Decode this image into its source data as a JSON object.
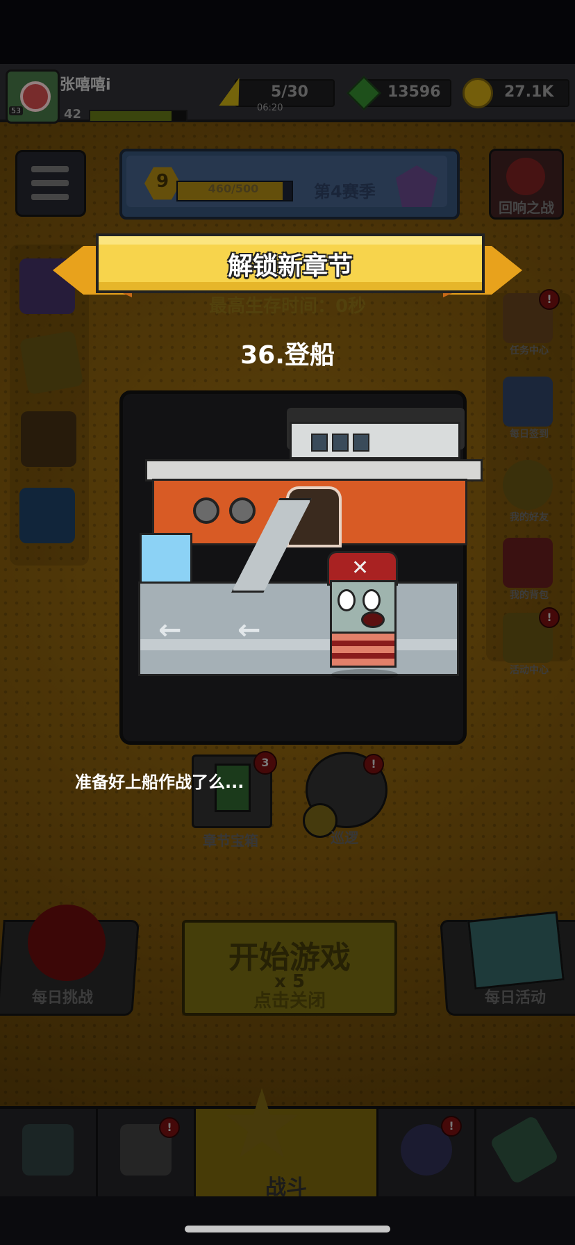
{
  "player": {
    "name": "张嘻嘻i",
    "avatar_level": "53",
    "level": "42",
    "xp_fraction": 0.85
  },
  "resources": {
    "energy": {
      "value": "5/30",
      "timer": "06:20",
      "icon": "lightning-icon"
    },
    "gems": {
      "value": "13596",
      "icon": "gem-icon"
    },
    "coins": {
      "value": "27.1K",
      "icon": "coin-icon"
    }
  },
  "season": {
    "level": "9",
    "progress_text": "460/500",
    "progress_fraction": 0.92,
    "label": "第4赛季"
  },
  "echo_battle": {
    "label": "回响之战"
  },
  "right_menu": [
    {
      "label": "任务中心",
      "icon": "task-board-icon",
      "alert": "!"
    },
    {
      "label": "每日签到",
      "icon": "calendar-check-icon",
      "alert": ""
    },
    {
      "label": "我的好友",
      "icon": "friends-icon",
      "alert": ""
    },
    {
      "label": "我的背包",
      "icon": "backpack-icon",
      "alert": ""
    },
    {
      "label": "活动中心",
      "icon": "party-popper-icon",
      "alert": "!"
    }
  ],
  "chapter_chest": {
    "label": "章节宝箱",
    "count": "3"
  },
  "patrol": {
    "label": "巡逻",
    "alert": "!"
  },
  "daily_challenge": {
    "label": "每日挑战"
  },
  "start_button": {
    "title": "开始游戏",
    "cost": "x 5",
    "hint": "点击关闭"
  },
  "daily_event": {
    "label": "每日活动"
  },
  "bottom_nav": {
    "battle_label": "战斗",
    "weapon_alert": "!",
    "talent_alert": "!"
  },
  "modal": {
    "banner": "解锁新章节",
    "best_survival": "最高生存时间：0秒",
    "chapter_title": "36.登船",
    "dialog": "准备好上船作战了么..."
  },
  "colors": {
    "banner_yellow": "#f7d44c",
    "banner_orange": "#e8a21c",
    "hull_orange": "#d85b25"
  }
}
